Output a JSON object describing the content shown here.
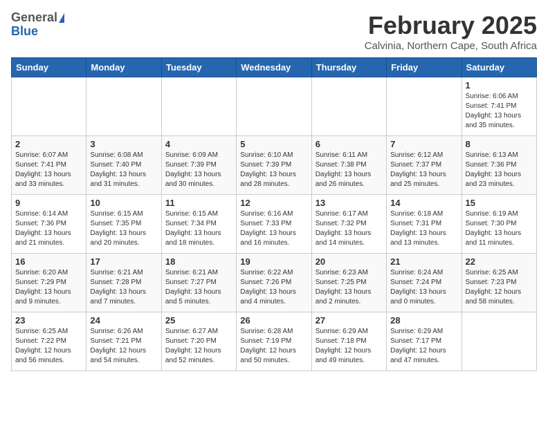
{
  "header": {
    "logo_general": "General",
    "logo_blue": "Blue",
    "title": "February 2025",
    "location": "Calvinia, Northern Cape, South Africa"
  },
  "weekdays": [
    "Sunday",
    "Monday",
    "Tuesday",
    "Wednesday",
    "Thursday",
    "Friday",
    "Saturday"
  ],
  "weeks": [
    [
      {
        "day": "",
        "info": ""
      },
      {
        "day": "",
        "info": ""
      },
      {
        "day": "",
        "info": ""
      },
      {
        "day": "",
        "info": ""
      },
      {
        "day": "",
        "info": ""
      },
      {
        "day": "",
        "info": ""
      },
      {
        "day": "1",
        "info": "Sunrise: 6:06 AM\nSunset: 7:41 PM\nDaylight: 13 hours\nand 35 minutes."
      }
    ],
    [
      {
        "day": "2",
        "info": "Sunrise: 6:07 AM\nSunset: 7:41 PM\nDaylight: 13 hours\nand 33 minutes."
      },
      {
        "day": "3",
        "info": "Sunrise: 6:08 AM\nSunset: 7:40 PM\nDaylight: 13 hours\nand 31 minutes."
      },
      {
        "day": "4",
        "info": "Sunrise: 6:09 AM\nSunset: 7:39 PM\nDaylight: 13 hours\nand 30 minutes."
      },
      {
        "day": "5",
        "info": "Sunrise: 6:10 AM\nSunset: 7:39 PM\nDaylight: 13 hours\nand 28 minutes."
      },
      {
        "day": "6",
        "info": "Sunrise: 6:11 AM\nSunset: 7:38 PM\nDaylight: 13 hours\nand 26 minutes."
      },
      {
        "day": "7",
        "info": "Sunrise: 6:12 AM\nSunset: 7:37 PM\nDaylight: 13 hours\nand 25 minutes."
      },
      {
        "day": "8",
        "info": "Sunrise: 6:13 AM\nSunset: 7:36 PM\nDaylight: 13 hours\nand 23 minutes."
      }
    ],
    [
      {
        "day": "9",
        "info": "Sunrise: 6:14 AM\nSunset: 7:36 PM\nDaylight: 13 hours\nand 21 minutes."
      },
      {
        "day": "10",
        "info": "Sunrise: 6:15 AM\nSunset: 7:35 PM\nDaylight: 13 hours\nand 20 minutes."
      },
      {
        "day": "11",
        "info": "Sunrise: 6:15 AM\nSunset: 7:34 PM\nDaylight: 13 hours\nand 18 minutes."
      },
      {
        "day": "12",
        "info": "Sunrise: 6:16 AM\nSunset: 7:33 PM\nDaylight: 13 hours\nand 16 minutes."
      },
      {
        "day": "13",
        "info": "Sunrise: 6:17 AM\nSunset: 7:32 PM\nDaylight: 13 hours\nand 14 minutes."
      },
      {
        "day": "14",
        "info": "Sunrise: 6:18 AM\nSunset: 7:31 PM\nDaylight: 13 hours\nand 13 minutes."
      },
      {
        "day": "15",
        "info": "Sunrise: 6:19 AM\nSunset: 7:30 PM\nDaylight: 13 hours\nand 11 minutes."
      }
    ],
    [
      {
        "day": "16",
        "info": "Sunrise: 6:20 AM\nSunset: 7:29 PM\nDaylight: 13 hours\nand 9 minutes."
      },
      {
        "day": "17",
        "info": "Sunrise: 6:21 AM\nSunset: 7:28 PM\nDaylight: 13 hours\nand 7 minutes."
      },
      {
        "day": "18",
        "info": "Sunrise: 6:21 AM\nSunset: 7:27 PM\nDaylight: 13 hours\nand 5 minutes."
      },
      {
        "day": "19",
        "info": "Sunrise: 6:22 AM\nSunset: 7:26 PM\nDaylight: 13 hours\nand 4 minutes."
      },
      {
        "day": "20",
        "info": "Sunrise: 6:23 AM\nSunset: 7:25 PM\nDaylight: 13 hours\nand 2 minutes."
      },
      {
        "day": "21",
        "info": "Sunrise: 6:24 AM\nSunset: 7:24 PM\nDaylight: 13 hours\nand 0 minutes."
      },
      {
        "day": "22",
        "info": "Sunrise: 6:25 AM\nSunset: 7:23 PM\nDaylight: 12 hours\nand 58 minutes."
      }
    ],
    [
      {
        "day": "23",
        "info": "Sunrise: 6:25 AM\nSunset: 7:22 PM\nDaylight: 12 hours\nand 56 minutes."
      },
      {
        "day": "24",
        "info": "Sunrise: 6:26 AM\nSunset: 7:21 PM\nDaylight: 12 hours\nand 54 minutes."
      },
      {
        "day": "25",
        "info": "Sunrise: 6:27 AM\nSunset: 7:20 PM\nDaylight: 12 hours\nand 52 minutes."
      },
      {
        "day": "26",
        "info": "Sunrise: 6:28 AM\nSunset: 7:19 PM\nDaylight: 12 hours\nand 50 minutes."
      },
      {
        "day": "27",
        "info": "Sunrise: 6:29 AM\nSunset: 7:18 PM\nDaylight: 12 hours\nand 49 minutes."
      },
      {
        "day": "28",
        "info": "Sunrise: 6:29 AM\nSunset: 7:17 PM\nDaylight: 12 hours\nand 47 minutes."
      },
      {
        "day": "",
        "info": ""
      }
    ]
  ]
}
